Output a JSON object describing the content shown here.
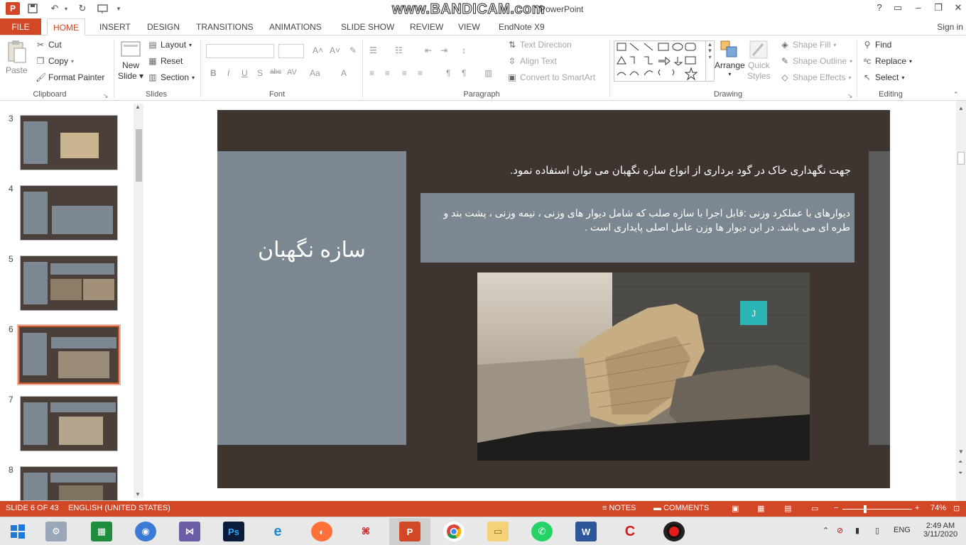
{
  "titlebar": {
    "watermark": "www.BANDICAM.com",
    "doc_title": "PowerPoint",
    "help": "?",
    "minimize": "–",
    "restore": "❐",
    "close": "✕",
    "ribbon_display": "▭"
  },
  "tabs": {
    "file": "FILE",
    "items": [
      "HOME",
      "INSERT",
      "DESIGN",
      "TRANSITIONS",
      "ANIMATIONS",
      "SLIDE SHOW",
      "REVIEW",
      "VIEW",
      "EndNote X9"
    ],
    "signin": "Sign in"
  },
  "ribbon": {
    "clipboard": {
      "label": "Clipboard",
      "paste": "Paste",
      "cut": "Cut",
      "copy": "Copy",
      "format_painter": "Format Painter"
    },
    "slides": {
      "label": "Slides",
      "new_slide": "New",
      "new_slide2": "Slide",
      "layout": "Layout",
      "reset": "Reset",
      "section": "Section"
    },
    "font": {
      "label": "Font",
      "bold": "B",
      "italic": "I",
      "underline": "U",
      "shadow": "S",
      "strike": "abc",
      "spacing": "AV",
      "case": "Aa"
    },
    "paragraph": {
      "label": "Paragraph",
      "text_direction": "Text Direction",
      "align_text": "Align Text",
      "smartart": "Convert to SmartArt"
    },
    "drawing": {
      "label": "Drawing",
      "arrange": "Arrange",
      "quick_styles": "Quick",
      "quick_styles2": "Styles",
      "shape_fill": "Shape Fill",
      "shape_outline": "Shape Outline",
      "shape_effects": "Shape Effects"
    },
    "editing": {
      "label": "Editing",
      "find": "Find",
      "replace": "Replace",
      "select": "Select"
    }
  },
  "thumbnails": [
    {
      "num": "3"
    },
    {
      "num": "4"
    },
    {
      "num": "5"
    },
    {
      "num": "6"
    },
    {
      "num": "7"
    },
    {
      "num": "8"
    }
  ],
  "slide": {
    "title": "سازه نگهبان",
    "intro": "جهت نگهداری خاک در گود برداری از انواع سازه نگهبان می توان استفاده نمود.",
    "body": "دیوارهای با عملکرد وزنی :قابل اجرا با سازه صلب که شامل دیوار های وزنی ، نیمه وزنی ، پشت بند و طره ای می باشد. در این دیوار ها وزن عامل اصلی پایداری است .",
    "photo_label": "J"
  },
  "statusbar": {
    "slide_info": "SLIDE 6 OF 43",
    "language": "ENGLISH (UNITED STATES)",
    "notes": "NOTES",
    "comments": "COMMENTS",
    "zoom": "74%"
  },
  "taskbar": {
    "language": "ENG",
    "time": "2:49 AM",
    "date": "3/11/2020"
  },
  "colors": {
    "accent": "#d24726",
    "slide_bg": "#3e3530",
    "slide_panel": "#7d8792"
  }
}
